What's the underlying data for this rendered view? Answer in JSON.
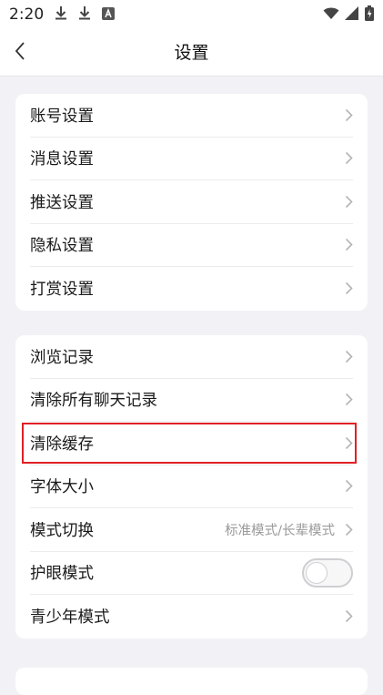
{
  "status_bar": {
    "time": "2:20",
    "icons": [
      "download-icon",
      "download-icon",
      "a-notification-icon",
      "wifi-icon",
      "signal-icon",
      "battery-icon"
    ]
  },
  "header": {
    "title": "设置",
    "back_icon": "chevron-left-icon"
  },
  "group1": {
    "items": [
      {
        "label": "账号设置"
      },
      {
        "label": "消息设置"
      },
      {
        "label": "推送设置"
      },
      {
        "label": "隐私设置"
      },
      {
        "label": "打赏设置"
      }
    ]
  },
  "group2": {
    "items": [
      {
        "label": "浏览记录"
      },
      {
        "label": "清除所有聊天记录"
      },
      {
        "label": "清除缓存"
      },
      {
        "label": "字体大小"
      },
      {
        "label": "模式切换",
        "value": "标准模式/长辈模式"
      },
      {
        "label": "护眼模式",
        "toggle_on": false
      },
      {
        "label": "青少年模式"
      }
    ]
  },
  "colors": {
    "background": "#f2f2f6",
    "card": "#ffffff",
    "highlight": "#e01f26",
    "secondary_text": "#9a9a9a"
  }
}
